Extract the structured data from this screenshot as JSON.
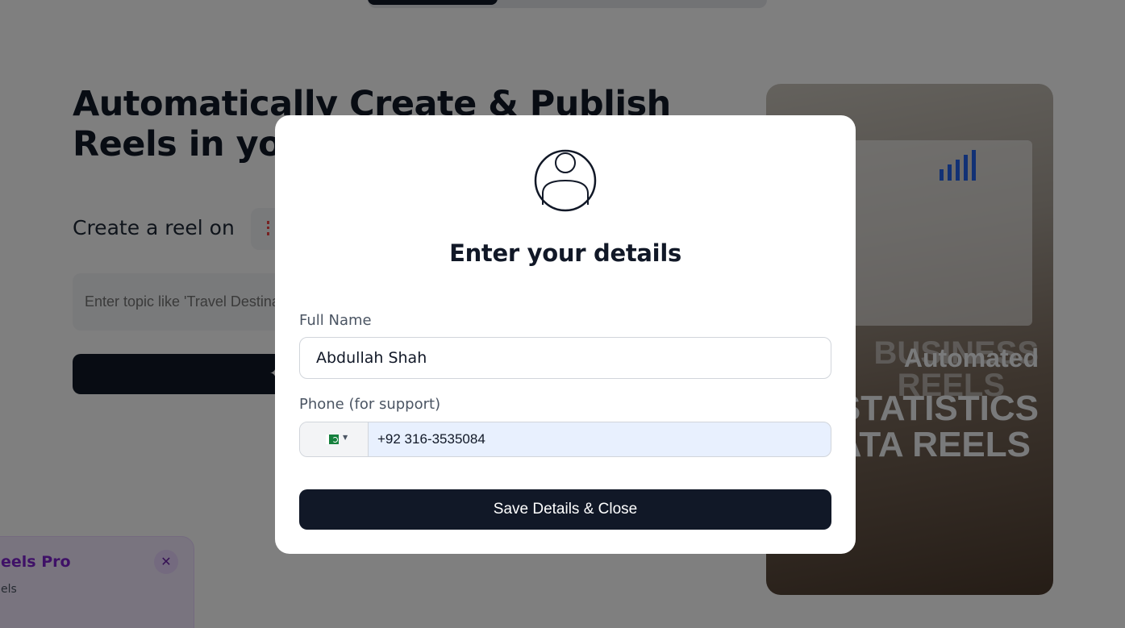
{
  "background": {
    "hero_title": "Automatically Create & Publish Reels in your",
    "create_on_label": "Create a reel on",
    "topic_placeholder": "Enter topic like 'Travel Destinations'",
    "preview": {
      "text_lines": [
        "BUSINESS",
        "Automated",
        "REELS",
        "STATISTICS",
        "DATA REELS"
      ]
    },
    "pro_card": {
      "title": "eels Pro",
      "subtitle": "els",
      "close_icon": "close-icon"
    }
  },
  "modal": {
    "icon": "user-avatar-icon",
    "title": "Enter your details",
    "full_name": {
      "label": "Full Name",
      "value": "Abdullah Shah"
    },
    "phone": {
      "label": "Phone (for support)",
      "country_flag": "pakistan-flag-icon",
      "value": "+92 316-3535084"
    },
    "save_label": "Save Details & Close"
  },
  "colors": {
    "primary": "#111827",
    "accent_purple": "#7e22ce",
    "autofill_bg": "#e8f0fe"
  }
}
